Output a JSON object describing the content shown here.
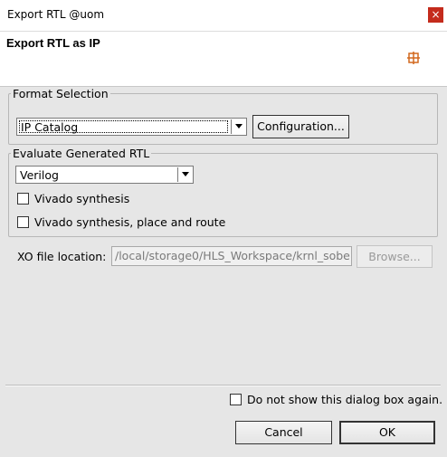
{
  "window": {
    "title": "Export RTL @uom",
    "close_glyph": "×"
  },
  "header": {
    "heading": "Export RTL as IP",
    "logo_icon": "xilinx-logo-icon"
  },
  "format_selection": {
    "legend": "Format Selection",
    "format_value": "IP Catalog",
    "configuration_label": "Configuration..."
  },
  "evaluate": {
    "legend": "Evaluate Generated RTL",
    "language_value": "Verilog",
    "vivado_synthesis_label": "Vivado synthesis",
    "vivado_synthesis_checked": false,
    "vivado_par_label": "Vivado synthesis, place and route",
    "vivado_par_checked": false
  },
  "xo": {
    "label": "XO file location:",
    "value": "/local/storage0/HLS_Workspace/krnl_sobe",
    "browse_label": "Browse..."
  },
  "footer": {
    "dont_show_label": "Do not show this dialog box again.",
    "dont_show_checked": false,
    "cancel_label": "Cancel",
    "ok_label": "OK"
  }
}
